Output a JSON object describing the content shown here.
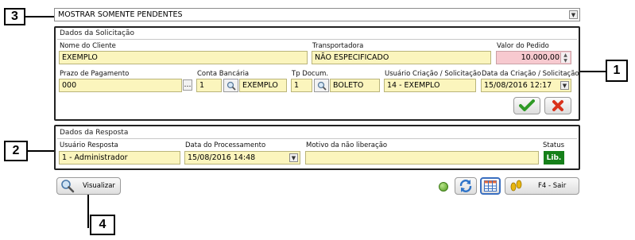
{
  "callouts": {
    "c1": "1",
    "c2": "2",
    "c3": "3",
    "c4": "4"
  },
  "filter": {
    "selected": "MOSTRAR SOMENTE PENDENTES"
  },
  "solicitacao": {
    "title": "Dados da Solicitação",
    "cliente_label": "Nome do Cliente",
    "cliente_value": "EXEMPLO",
    "transportadora_label": "Transportadora",
    "transportadora_value": "NÃO ESPECIFICADO",
    "valor_label": "Valor do Pedido",
    "valor_value": "10.000,00",
    "prazo_label": "Prazo de Pagamento",
    "prazo_value": "000",
    "conta_label": "Conta Bancária",
    "conta_code": "1",
    "conta_name": "EXEMPLO",
    "tpdoc_label": "Tp Docum.",
    "tpdoc_code": "1",
    "tpdoc_name": "BOLETO",
    "usuario_label": "Usuário Criação / Solicitação",
    "usuario_value": "14 - EXEMPLO",
    "data_label": "Data da Criação / Solicitação",
    "data_value": "15/08/2016 12:17"
  },
  "resposta": {
    "title": "Dados da Resposta",
    "usuario_label": "Usuário Resposta",
    "usuario_value": "1 - Administrador",
    "data_label": "Data do Processamento",
    "data_value": "15/08/2016 14:48",
    "motivo_label": "Motivo da não liberação",
    "motivo_value": "",
    "status_label": "Status",
    "status_value": "Lib."
  },
  "toolbar": {
    "visualizar": "Visualizar",
    "sair": "F4 - Sair"
  },
  "colors": {
    "field": "#fbf5bd",
    "pink": "#f7c9cf",
    "status": "#16801a"
  }
}
